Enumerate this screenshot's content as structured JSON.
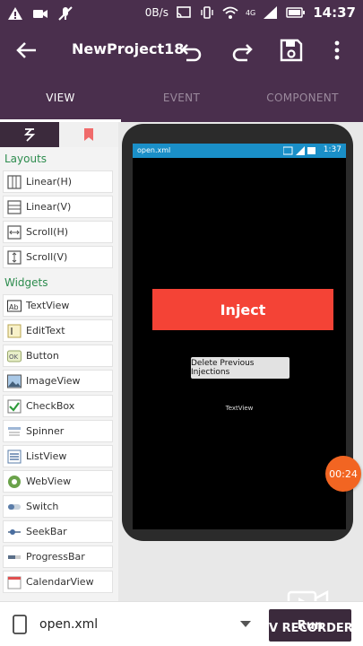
{
  "status_bar": {
    "speed": "0B/s",
    "network": "4G",
    "time": "14:37"
  },
  "toolbar": {
    "title": "NewProject18"
  },
  "tabs": [
    {
      "label": "VIEW"
    },
    {
      "label": "EVENT"
    },
    {
      "label": "COMPONENT"
    }
  ],
  "palette": {
    "layouts_title": "Layouts",
    "layouts": [
      {
        "label": "Linear(H)",
        "icon": "linear-h-icon"
      },
      {
        "label": "Linear(V)",
        "icon": "linear-v-icon"
      },
      {
        "label": "Scroll(H)",
        "icon": "scroll-h-icon"
      },
      {
        "label": "Scroll(V)",
        "icon": "scroll-v-icon"
      }
    ],
    "widgets_title": "Widgets",
    "widgets": [
      {
        "label": "TextView",
        "icon": "textview-icon"
      },
      {
        "label": "EditText",
        "icon": "edittext-icon"
      },
      {
        "label": "Button",
        "icon": "button-icon"
      },
      {
        "label": "ImageView",
        "icon": "imageview-icon"
      },
      {
        "label": "CheckBox",
        "icon": "checkbox-icon"
      },
      {
        "label": "Spinner",
        "icon": "spinner-icon"
      },
      {
        "label": "ListView",
        "icon": "listview-icon"
      },
      {
        "label": "WebView",
        "icon": "webview-icon"
      },
      {
        "label": "Switch",
        "icon": "switch-icon"
      },
      {
        "label": "SeekBar",
        "icon": "seekbar-icon"
      },
      {
        "label": "ProgressBar",
        "icon": "progressbar-icon"
      },
      {
        "label": "CalendarView",
        "icon": "calendarview-icon"
      }
    ]
  },
  "preview": {
    "filename": "open.xml",
    "time": "1:37",
    "inject_label": "Inject",
    "delete_label": "Delete Previous Injections",
    "textview_label": "TextView"
  },
  "recorder": {
    "timer": "00:24",
    "label": "V RECORDER"
  },
  "bottom_bar": {
    "filename": "open.xml",
    "run_label": "Run"
  },
  "colors": {
    "primary": "#4a2f4d",
    "accent_green": "#2d8c4e",
    "inject_red": "#f44336",
    "preview_status": "#1a8fc8",
    "timer_orange": "#f26522"
  }
}
